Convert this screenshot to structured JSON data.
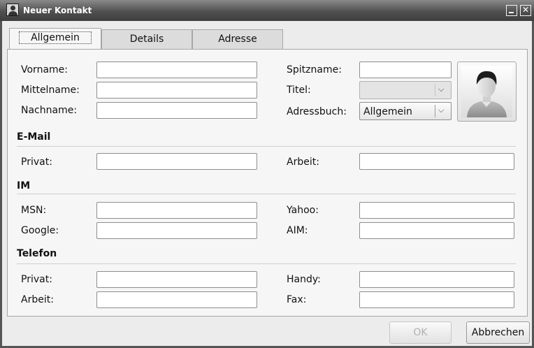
{
  "window": {
    "title": "Neuer Kontakt",
    "close_glyph": "✕",
    "icons": [
      "contact-icon",
      "minimize-icon",
      "close-icon"
    ]
  },
  "tabs": [
    {
      "label": "Allgemein",
      "active": true
    },
    {
      "label": "Details",
      "active": false
    },
    {
      "label": "Adresse",
      "active": false
    }
  ],
  "name_section": {
    "vorname_label": "Vorname:",
    "mittelname_label": "Mittelname:",
    "nachname_label": "Nachname:",
    "spitzname_label": "Spitzname:",
    "titel_label": "Titel:",
    "titel_value": "",
    "adressbuch_label": "Adressbuch:",
    "adressbuch_value": "Allgemein",
    "vorname_value": "",
    "mittelname_value": "",
    "nachname_value": "",
    "spitzname_value": "",
    "photo_icon": "person-avatar-icon"
  },
  "email_section": {
    "heading": "E-Mail",
    "privat_label": "Privat:",
    "arbeit_label": "Arbeit:",
    "privat_value": "",
    "arbeit_value": ""
  },
  "im_section": {
    "heading": "IM",
    "msn_label": "MSN:",
    "yahoo_label": "Yahoo:",
    "google_label": "Google:",
    "aim_label": "AIM:",
    "msn_value": "",
    "yahoo_value": "",
    "google_value": "",
    "aim_value": ""
  },
  "phone_section": {
    "heading": "Telefon",
    "privat_label": "Privat:",
    "handy_label": "Handy:",
    "arbeit_label": "Arbeit:",
    "fax_label": "Fax:",
    "privat_value": "",
    "handy_value": "",
    "arbeit_value": "",
    "fax_value": ""
  },
  "buttons": {
    "ok_label": "OK",
    "ok_enabled": false,
    "cancel_label": "Abbrechen"
  },
  "dropdown_arrow": "⌵",
  "colors": {
    "titlebar_dark": "#3e3e3e",
    "window_bg": "#ececec",
    "panel_bg": "#f6f6f6",
    "disabled_text": "#b0b0b0"
  }
}
